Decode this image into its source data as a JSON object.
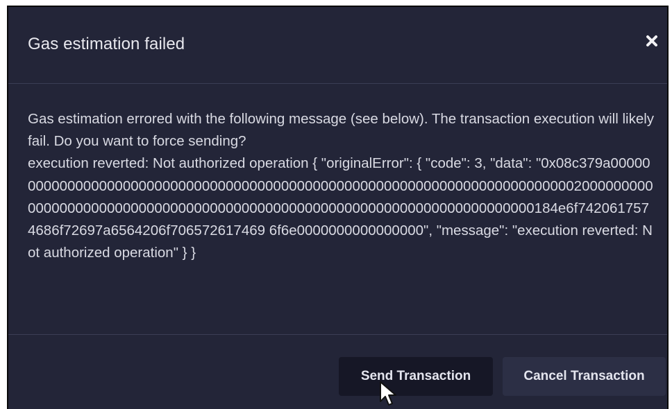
{
  "dialog": {
    "title": "Gas estimation failed",
    "close_icon": "close-icon",
    "message": "Gas estimation errored with the following message (see below). The transaction execution will likely fail. Do you want to force sending?\nexecution reverted: Not authorized operation { \"originalError\": { \"code\": 3, \"data\": \"0x08c379a0000000000000000000000000000000000000000000000000000000000000000000000000020000000000000000000000000000000000000000000000000000000000000000000000000184e6f7420617574686f72697a6564206f706572617469 6f6e0000000000000000\", \"message\": \"execution reverted: Not authorized operation\" } }",
    "buttons": {
      "send_label": "Send Transaction",
      "cancel_label": "Cancel Transaction"
    }
  },
  "colors": {
    "background": "#232538",
    "divider": "#3b3e55",
    "send_button": "#161726",
    "cancel_button": "#2c2f45",
    "text": "#d9dae3"
  }
}
